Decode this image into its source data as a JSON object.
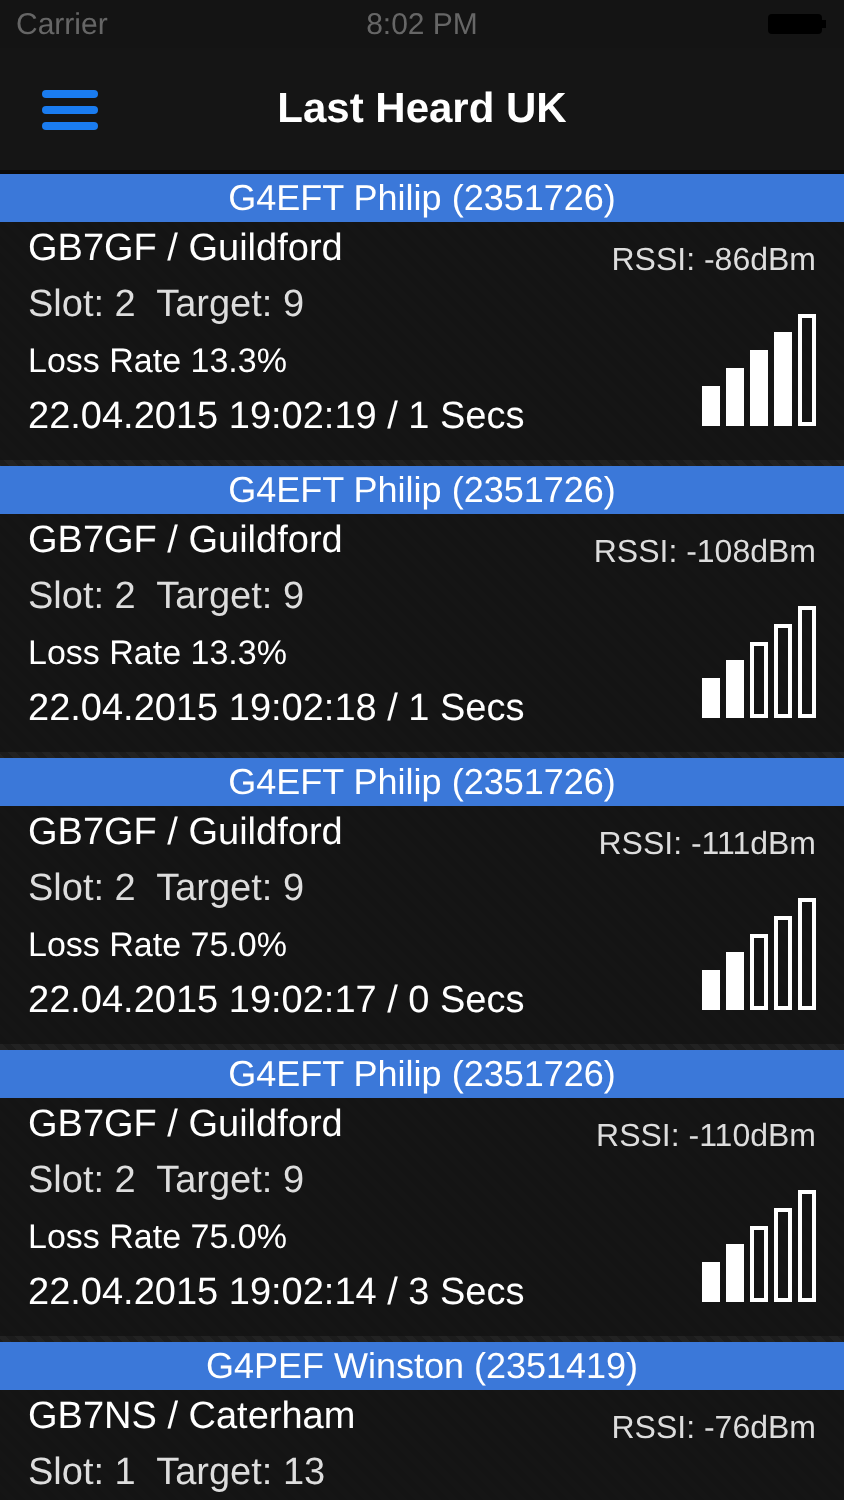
{
  "status_bar": {
    "carrier": "Carrier",
    "time": "8:02 PM"
  },
  "nav": {
    "title": "Last Heard UK"
  },
  "entries": [
    {
      "header": "G4EFT Philip (2351726)",
      "repeater": "GB7GF / Guildford",
      "rssi": "RSSI: -86dBm",
      "slot": "Slot: 2  Target: 9",
      "loss": "Loss Rate 13.3%",
      "time": "22.04.2015 19:02:19 / 1 Secs",
      "level": 0.8
    },
    {
      "header": "G4EFT Philip (2351726)",
      "repeater": "GB7GF / Guildford",
      "rssi": "RSSI: -108dBm",
      "slot": "Slot: 2  Target: 9",
      "loss": "Loss Rate 13.3%",
      "time": "22.04.2015 19:02:18 / 1 Secs",
      "level": 0.4
    },
    {
      "header": "G4EFT Philip (2351726)",
      "repeater": "GB7GF / Guildford",
      "rssi": "RSSI: -111dBm",
      "slot": "Slot: 2  Target: 9",
      "loss": "Loss Rate 75.0%",
      "time": "22.04.2015 19:02:17 / 0 Secs",
      "level": 0.4
    },
    {
      "header": "G4EFT Philip (2351726)",
      "repeater": "GB7GF / Guildford",
      "rssi": "RSSI: -110dBm",
      "slot": "Slot: 2  Target: 9",
      "loss": "Loss Rate 75.0%",
      "time": "22.04.2015 19:02:14 / 3 Secs",
      "level": 0.4
    },
    {
      "header": "G4PEF Winston (2351419)",
      "repeater": "GB7NS / Caterham",
      "rssi": "RSSI: -76dBm",
      "slot": "Slot: 1  Target: 13"
    }
  ]
}
